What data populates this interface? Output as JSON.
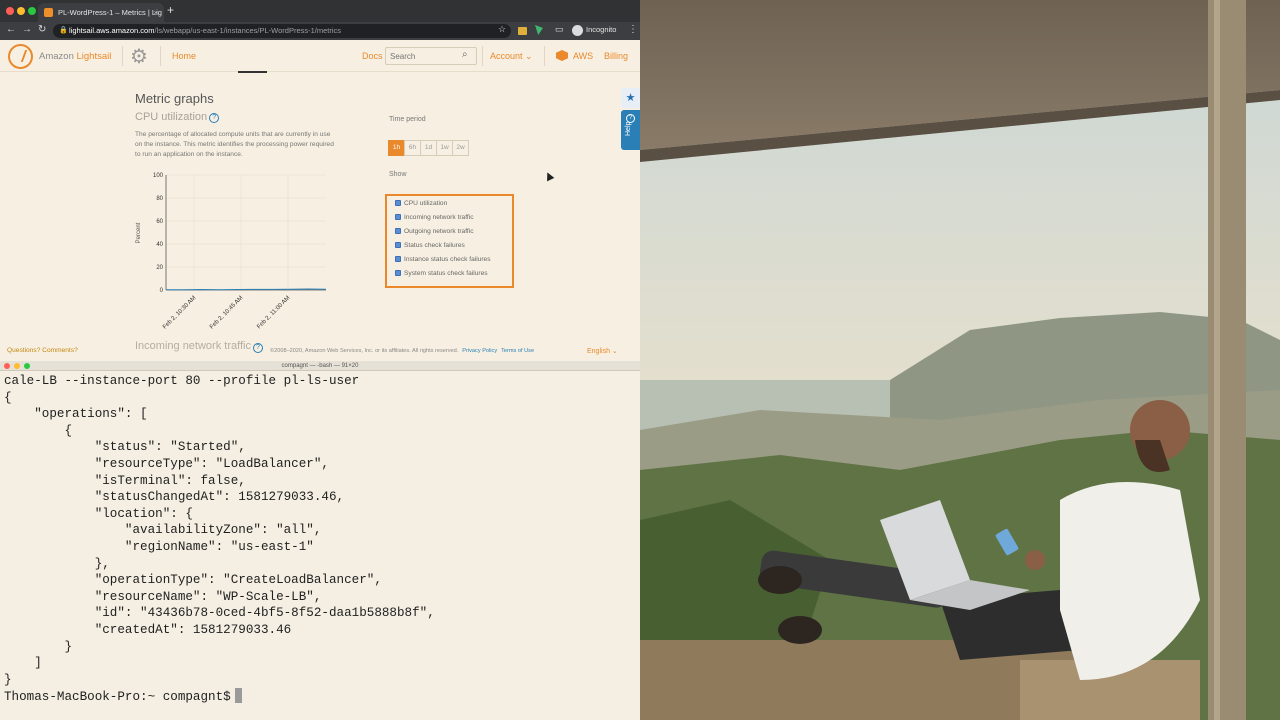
{
  "browser": {
    "tab_title": "PL-WordPress-1 – Metrics | Lig",
    "url_host": "lightsail.aws.amazon.com",
    "url_path": "/ls/webapp/us-east-1/instances/PL-WordPress-1/metrics",
    "incognito_label": "Incognito"
  },
  "header": {
    "brand_prefix": "Amazon ",
    "brand_name": "Lightsail",
    "home": "Home",
    "docs": "Docs",
    "search_placeholder": "Search",
    "account": "Account",
    "aws": "AWS",
    "billing": "Billing"
  },
  "main": {
    "title": "Metric graphs",
    "cpu_title": "CPU utilization",
    "description": "The percentage of allocated compute units that are currently in use on the instance. This metric identifies the processing power required to run an application on the instance.",
    "time_period_label": "Time period",
    "time_periods": [
      "1h",
      "6h",
      "1d",
      "1w",
      "2w"
    ],
    "active_period": "1h",
    "show_label": "Show",
    "show_options": [
      {
        "label": "CPU utilization",
        "checked": true
      },
      {
        "label": "Incoming network traffic",
        "checked": true
      },
      {
        "label": "Outgoing network traffic",
        "checked": true
      },
      {
        "label": "Status check failures",
        "checked": true
      },
      {
        "label": "Instance status check failures",
        "checked": true
      },
      {
        "label": "System status check failures",
        "checked": true
      }
    ],
    "next_section": "Incoming network traffic",
    "help_tab": "Help"
  },
  "chart_data": {
    "type": "line",
    "ylabel": "Percent",
    "ylim": [
      0,
      100
    ],
    "yticks": [
      0,
      20,
      40,
      60,
      80,
      100
    ],
    "xticks": [
      "Feb 2, 10:30 AM",
      "Feb 2, 10:45 AM",
      "Feb 2, 11:00 AM"
    ],
    "series": [
      {
        "values": [
          0.3,
          0.3,
          0.4,
          0.3,
          0.4,
          0.5,
          0.5,
          0.6,
          0.9,
          0.6
        ]
      }
    ],
    "color": "#2a7fb6"
  },
  "footer": {
    "questions": "Questions? Comments?",
    "copyright": "©2008–2020, Amazon Web Services, Inc. or its affiliates. All rights reserved.",
    "privacy": "Privacy Policy",
    "terms": "Terms of Use",
    "language": "English"
  },
  "terminal": {
    "title": "compagnt — -bash — 91×20",
    "lines": [
      "cale-LB --instance-port 80 --profile pl-ls-user",
      "{",
      "    \"operations\": [",
      "        {",
      "            \"status\": \"Started\",",
      "            \"resourceType\": \"LoadBalancer\",",
      "            \"isTerminal\": false,",
      "            \"statusChangedAt\": 1581279033.46,",
      "            \"location\": {",
      "                \"availabilityZone\": \"all\",",
      "                \"regionName\": \"us-east-1\"",
      "            },",
      "            \"operationType\": \"CreateLoadBalancer\",",
      "            \"resourceName\": \"WP-Scale-LB\",",
      "            \"id\": \"43436b78-0ced-4bf5-8f52-daa1b5888b8f\",",
      "            \"createdAt\": 1581279033.46",
      "        }",
      "    ]",
      "}"
    ],
    "prompt": "Thomas-MacBook-Pro:~ compagnt$"
  }
}
